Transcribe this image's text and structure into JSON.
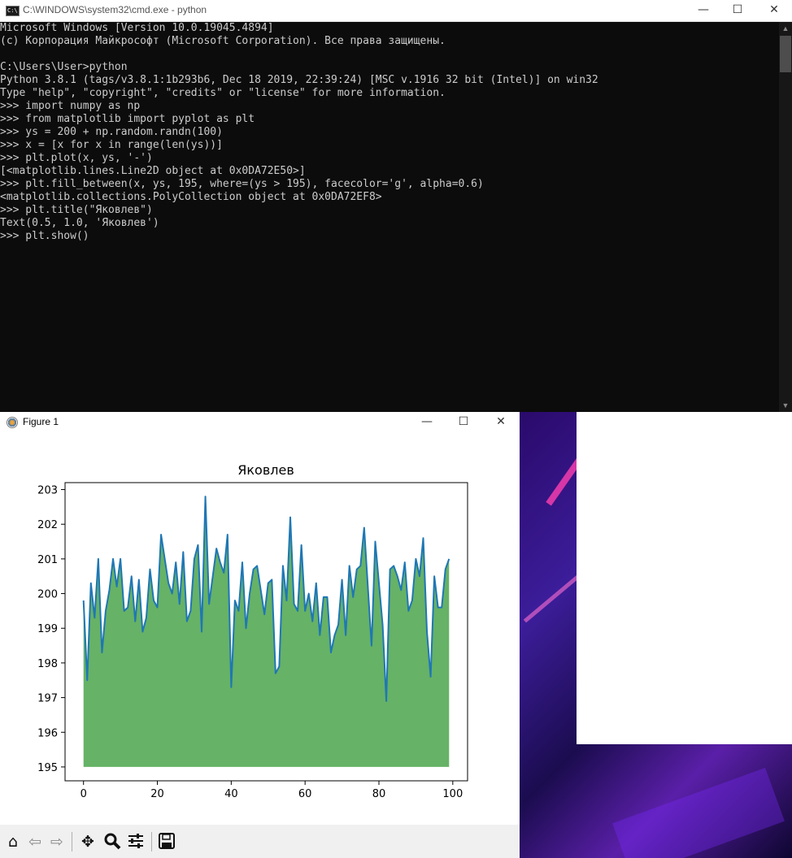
{
  "cmd_window": {
    "title": "C:\\WINDOWS\\system32\\cmd.exe - python",
    "lines": [
      "Microsoft Windows [Version 10.0.19045.4894]",
      "(c) Корпорация Майкрософт (Microsoft Corporation). Все права защищены.",
      "",
      "C:\\Users\\User>python",
      "Python 3.8.1 (tags/v3.8.1:1b293b6, Dec 18 2019, 22:39:24) [MSC v.1916 32 bit (Intel)] on win32",
      "Type \"help\", \"copyright\", \"credits\" or \"license\" for more information.",
      ">>> import numpy as np",
      ">>> from matplotlib import pyplot as plt",
      ">>> ys = 200 + np.random.randn(100)",
      ">>> x = [x for x in range(len(ys))]",
      ">>> plt.plot(x, ys, '-')",
      "[<matplotlib.lines.Line2D object at 0x0DA72E50>]",
      ">>> plt.fill_between(x, ys, 195, where=(ys > 195), facecolor='g', alpha=0.6)",
      "<matplotlib.collections.PolyCollection object at 0x0DA72EF8>",
      ">>> plt.title(\"Яковлев\")",
      "Text(0.5, 1.0, 'Яковлев')",
      ">>> plt.show()"
    ],
    "icon": "cmd-icon",
    "controls": {
      "minimize": "—",
      "maximize": "☐",
      "close": "✕"
    }
  },
  "figure_window": {
    "title": "Figure 1",
    "icon": "matplotlib-icon",
    "controls": {
      "minimize": "—",
      "maximize": "☐",
      "close": "✕"
    },
    "toolbar": [
      "home-icon",
      "back-icon",
      "forward-icon",
      "pan-icon",
      "zoom-icon",
      "configure-subplots-icon",
      "save-icon"
    ]
  },
  "colors": {
    "line": "#1f77b4",
    "fill": "#66b266",
    "console_bg": "#0c0c0c",
    "console_text": "#cccccc"
  },
  "chart_data": {
    "type": "line",
    "title": "Яковлев",
    "xlabel": "",
    "ylabel": "",
    "xlim": [
      -5,
      104
    ],
    "ylim": [
      194.6,
      203.2
    ],
    "xticks": [
      0,
      20,
      40,
      60,
      80,
      100
    ],
    "yticks": [
      195,
      196,
      197,
      198,
      199,
      200,
      201,
      202,
      203
    ],
    "fill_baseline": 195,
    "x": [
      0,
      1,
      2,
      3,
      4,
      5,
      6,
      7,
      8,
      9,
      10,
      11,
      12,
      13,
      14,
      15,
      16,
      17,
      18,
      19,
      20,
      21,
      22,
      23,
      24,
      25,
      26,
      27,
      28,
      29,
      30,
      31,
      32,
      33,
      34,
      35,
      36,
      37,
      38,
      39,
      40,
      41,
      42,
      43,
      44,
      45,
      46,
      47,
      48,
      49,
      50,
      51,
      52,
      53,
      54,
      55,
      56,
      57,
      58,
      59,
      60,
      61,
      62,
      63,
      64,
      65,
      66,
      67,
      68,
      69,
      70,
      71,
      72,
      73,
      74,
      75,
      76,
      77,
      78,
      79,
      80,
      81,
      82,
      83,
      84,
      85,
      86,
      87,
      88,
      89,
      90,
      91,
      92,
      93,
      94,
      95,
      96,
      97,
      98,
      99
    ],
    "y": [
      199.8,
      197.5,
      200.3,
      199.3,
      201.0,
      198.3,
      199.5,
      200.1,
      201.0,
      200.2,
      201.0,
      199.5,
      199.6,
      200.5,
      199.2,
      200.4,
      198.9,
      199.3,
      200.7,
      199.8,
      199.6,
      201.7,
      201.0,
      200.3,
      200.0,
      200.9,
      199.7,
      201.2,
      199.2,
      199.5,
      201.0,
      201.4,
      198.9,
      202.8,
      199.7,
      200.5,
      201.3,
      200.9,
      200.6,
      201.7,
      197.3,
      199.8,
      199.5,
      200.9,
      199.0,
      200.0,
      200.7,
      200.8,
      200.1,
      199.4,
      200.3,
      200.4,
      197.7,
      197.9,
      200.8,
      199.8,
      202.2,
      199.7,
      199.5,
      201.4,
      199.5,
      200.0,
      199.2,
      200.3,
      198.8,
      199.9,
      199.9,
      198.3,
      198.8,
      199.1,
      200.4,
      198.8,
      200.8,
      199.9,
      200.7,
      200.8,
      201.9,
      200.2,
      198.5,
      201.5,
      200.3,
      199.1,
      196.9,
      200.7,
      200.8,
      200.5,
      200.1,
      200.9,
      199.5,
      199.8,
      201.0,
      200.5,
      201.6,
      198.9,
      197.6,
      200.5,
      199.6,
      199.6,
      200.7,
      201.0
    ]
  }
}
